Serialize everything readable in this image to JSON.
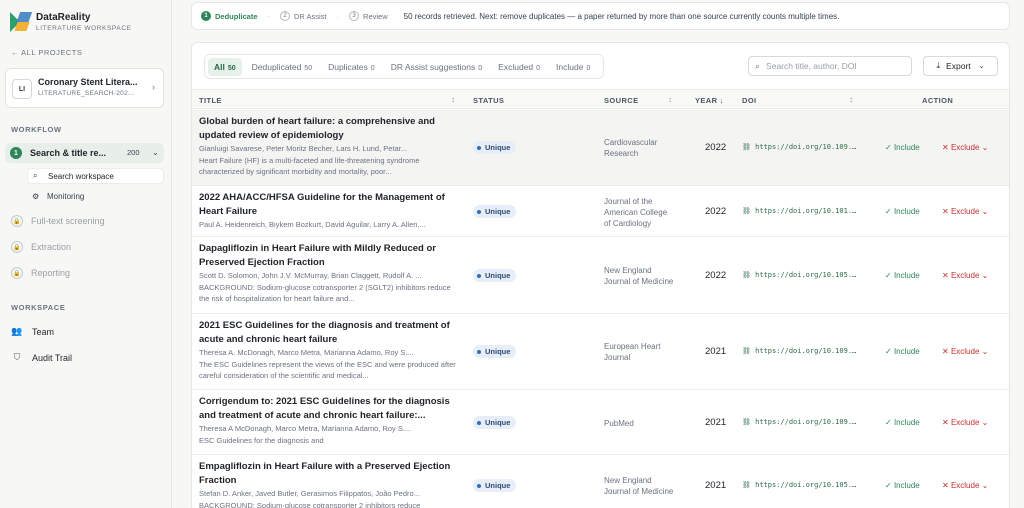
{
  "brand": {
    "name": "DataReality",
    "subtitle": "LITERATURE WORKSPACE"
  },
  "nav": {
    "all_projects": "ALL PROJECTS"
  },
  "project": {
    "badge": "LI",
    "title": "Coronary Stent Litera...",
    "subtitle": "LITERATURE_SEARCH-202..."
  },
  "workflow": {
    "label": "WORKFLOW",
    "active": {
      "num": "1",
      "label": "Search & title re...",
      "count": "200"
    },
    "sub_items": [
      {
        "label": "Search workspace",
        "icon": "search-icon"
      },
      {
        "label": "Monitoring",
        "icon": "gear-icon"
      }
    ],
    "locked": [
      {
        "label": "Full-text screening"
      },
      {
        "label": "Extraction"
      },
      {
        "label": "Reporting"
      }
    ]
  },
  "workspace": {
    "label": "WORKSPACE",
    "items": [
      {
        "label": "Team",
        "icon": "team-icon"
      },
      {
        "label": "Audit Trail",
        "icon": "shield-icon"
      }
    ]
  },
  "steps": [
    {
      "num": "1",
      "label": "Deduplicate"
    },
    {
      "num": "2",
      "label": "DR Assist"
    },
    {
      "num": "3",
      "label": "Review"
    }
  ],
  "step_message": "50 records retrieved. Next: remove duplicates — a paper returned by more than one source currently counts multiple times.",
  "tabs": [
    {
      "label": "All",
      "count": "50"
    },
    {
      "label": "Deduplicated",
      "count": "50"
    },
    {
      "label": "Duplicates",
      "count": "0"
    },
    {
      "label": "DR Assist suggestions",
      "count": "0"
    },
    {
      "label": "Excluded",
      "count": "0"
    },
    {
      "label": "Include",
      "count": "0"
    }
  ],
  "search": {
    "placeholder": "Search title, author, DOI",
    "value": ""
  },
  "export_label": "Export",
  "columns": {
    "title": "TITLE",
    "status": "STATUS",
    "source": "SOURCE",
    "year": "YEAR",
    "year_sort": "↓",
    "doi": "DOI",
    "action": "ACTION"
  },
  "actions": {
    "include": "Include",
    "exclude": "Exclude"
  },
  "rows": [
    {
      "title": "Global burden of heart failure: a comprehensive and updated review of epidemiology",
      "authors": "Gianluigi Savarese, Peter Moritz Becher, Lars H. Lund, Petar...",
      "abstract": "Heart Failure (HF) is a multi-faceted and life-threatening syndrome characterized by significant morbidity and mortality, poor...",
      "status": "Unique",
      "source": "Cardiovascular Research",
      "year": "2022",
      "doi": "https://doi.org/10.109..."
    },
    {
      "title": "2022 AHA/ACC/HFSA Guideline for the Management of Heart Failure",
      "authors": "Paul A. Heidenreich, Biykem Bozkurt, David Aguilar, Larry A. Allen,...",
      "abstract": "",
      "status": "Unique",
      "source": "Journal of the American College of Cardiology",
      "year": "2022",
      "doi": "https://doi.org/10.101..."
    },
    {
      "title": "Dapagliflozin in Heart Failure with Mildly Reduced or Preserved Ejection Fraction",
      "authors": "Scott D. Solomon, John J.V. McMurray, Brian Claggett, Rudolf A. ...",
      "abstract": "BACKGROUND: Sodium-glucose cotransporter 2 (SGLT2) inhibitors reduce the risk of hospitalization for heart failure and...",
      "status": "Unique",
      "source": "New England Journal of Medicine",
      "year": "2022",
      "doi": "https://doi.org/10.105..."
    },
    {
      "title": "2021 ESC Guidelines for the diagnosis and treatment of acute and chronic heart failure",
      "authors": "Theresa A. McDonagh, Marco Metra, Marianna Adamo, Roy S....",
      "abstract": "The ESC Guidelines represent the views of the ESC and were produced after careful consideration of the scientific and medical...",
      "status": "Unique",
      "source": "European Heart Journal",
      "year": "2021",
      "doi": "https://doi.org/10.109..."
    },
    {
      "title": "Corrigendum to: 2021 ESC Guidelines for the diagnosis and treatment of acute and chronic heart failure:...",
      "authors": "Theresa A McDonagh, Marco Metra, Marianna Adamo, Roy S....",
      "abstract": "ESC Guidelines for the diagnosis and",
      "status": "Unique",
      "source": "PubMed",
      "year": "2021",
      "doi": "https://doi.org/10.109..."
    },
    {
      "title": "Empagliflozin in Heart Failure with a Preserved Ejection Fraction",
      "authors": "Stefan D. Anker, Javed Butler, Gerasimos Filippatos, João Pedro...",
      "abstract": "BACKGROUND: Sodium-glucose cotransporter 2 inhibitors reduce",
      "status": "Unique",
      "source": "New England Journal of Medicine",
      "year": "2021",
      "doi": "https://doi.org/10.105..."
    }
  ]
}
